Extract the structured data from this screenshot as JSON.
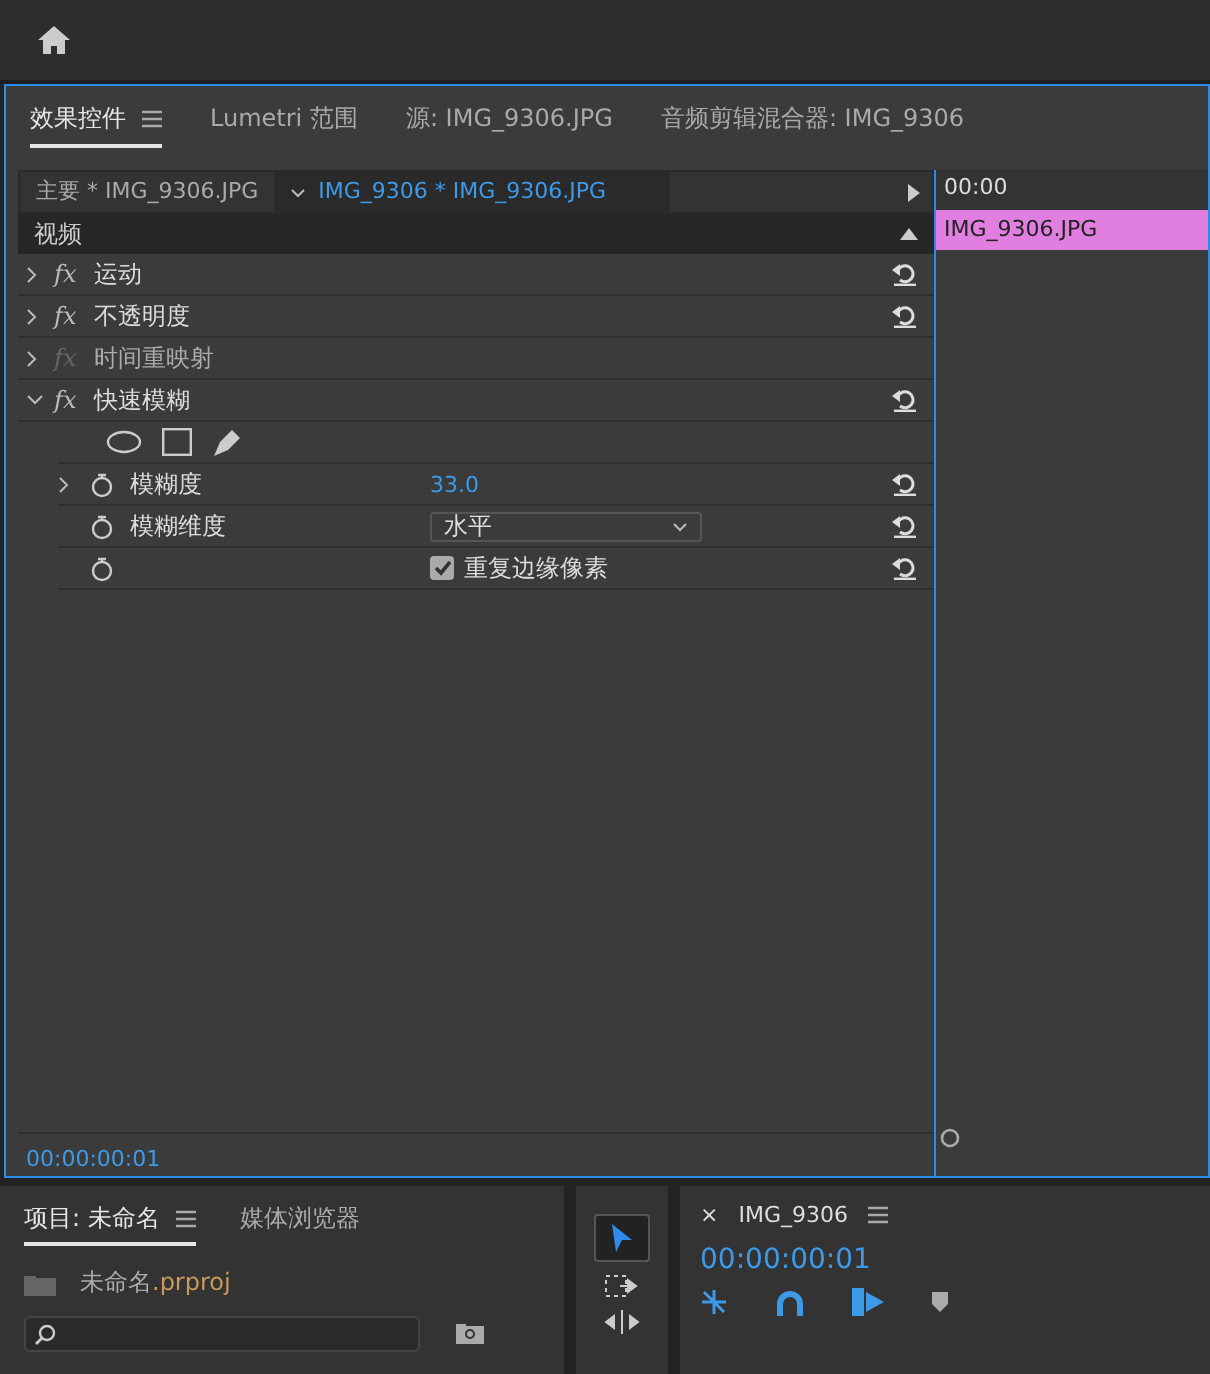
{
  "panel_tabs": [
    {
      "label": "效果控件",
      "selected": true
    },
    {
      "label": "Lumetri 范围",
      "selected": false
    },
    {
      "label": "源: IMG_9306.JPG",
      "selected": false
    },
    {
      "label": "音频剪辑混合器: IMG_9306",
      "selected": false
    }
  ],
  "source_tabs": [
    {
      "label": "主要 * IMG_9306.JPG",
      "selected": false
    },
    {
      "label": "IMG_9306 * IMG_9306.JPG",
      "selected": true
    }
  ],
  "ruler_time": "00:00",
  "clip": "IMG_9306.JPG",
  "section": "视频",
  "effects": [
    {
      "badge": "fx",
      "name": "运动",
      "expanded": false,
      "enabled": true,
      "reset": true
    },
    {
      "badge": "fx",
      "name": "不透明度",
      "expanded": false,
      "enabled": true,
      "reset": true
    },
    {
      "badge": "fx",
      "name": "时间重映射",
      "expanded": false,
      "enabled": false,
      "reset": false
    },
    {
      "badge": "fx",
      "name": "快速模糊",
      "expanded": true,
      "enabled": true,
      "reset": true,
      "properties": [
        {
          "kind": "shapes"
        },
        {
          "kind": "value",
          "name": "模糊度",
          "value": "33.0",
          "expandable": true
        },
        {
          "kind": "dropdown",
          "name": "模糊维度",
          "value": "水平",
          "expandable": false
        },
        {
          "kind": "checkbox",
          "label": "重复边缘像素",
          "checked": true,
          "expandable": false
        }
      ]
    }
  ],
  "timecode": "00:00:00:01",
  "project": {
    "tabs": [
      {
        "label": "项目: 未命名",
        "selected": true
      },
      {
        "label": "媒体浏览器",
        "selected": false
      }
    ],
    "file_name": "未命名",
    "file_ext": ".prproj"
  },
  "sequence": {
    "close": "×",
    "title": "IMG_9306",
    "timecode": "00:00:00:01"
  }
}
